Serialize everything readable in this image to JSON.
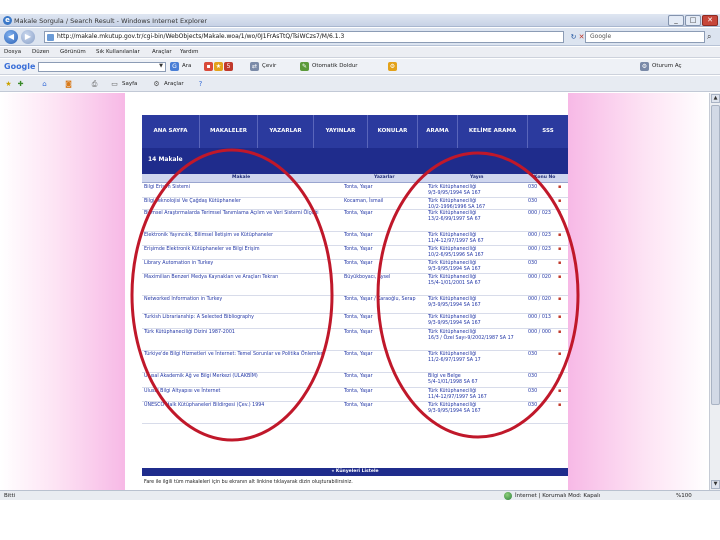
{
  "window": {
    "title": "Makale Sorgula / Search Result - Windows Internet Explorer",
    "btn_min": "_",
    "btn_max": "□",
    "btn_close": "✕"
  },
  "address": {
    "back": "◀",
    "forward": "▶",
    "url": "http://makale.mkutup.gov.tr/cgi-bin/WebObjects/Makale.woa/1/wo/0J1FrAsTtQ/TsiWCzs7/M/6.1.3",
    "refresh": "↻",
    "stop": "✕",
    "search_placeholder": "Google"
  },
  "menu": [
    "Dosya",
    "Düzen",
    "Görünüm",
    "Sık Kullanılanlar",
    "Araçlar",
    "Yardım"
  ],
  "google_toolbar": {
    "logo": "Google",
    "search_label": "Ara",
    "share_label": "Çevir",
    "autofill_label": "Otomatik Doldur",
    "signin_label": "Oturum Aç"
  },
  "fav_toolbar": {
    "page_label": "Sayfa",
    "tools_label": "Araçlar"
  },
  "nav": [
    "ANA SAYFA",
    "MAKALELER",
    "YAZARLAR",
    "YAYINLAR",
    "KONULAR",
    "ARAMA",
    "KELİME ARAMA",
    "SSS"
  ],
  "section_title": "14 Makale",
  "columns": {
    "title": "Makale",
    "author": "Yazarlar",
    "journal": "Yayın",
    "pages": "Konu No"
  },
  "rows": [
    {
      "title": "Bilgi Erişim Sistemi",
      "author": "Tonta, Yaşar",
      "journal": "Türk Kütüphaneciliği\n9/3-9/95/1994 SA 167",
      "pages": "030",
      "icon": "▪"
    },
    {
      "title": "Bilgi Teknolojisi Ve Çağdaş Kütüphaneler",
      "author": "Kocaman, İsmail",
      "journal": "Türk Kütüphaneciliği\n10/2-1996/1996 SA 167",
      "pages": "030",
      "icon": "▪"
    },
    {
      "title": "Bilimsel Araştırmalarda Terimsel Tanımlama Açılım ve Veri Sistemi Ölçeği",
      "author": "Tonta, Yaşar",
      "journal": "Türk Kütüphaneciliği\n13/2-6/99/1997 SA 67",
      "pages": "000 / 023",
      "icon": "▪"
    },
    {
      "title": "Elektronik Yayıncılık, Bilimsel İletişim ve Kütüphaneler",
      "author": "Tonta, Yaşar",
      "journal": "Türk Kütüphaneciliği\n11/4-12/97/1997 SA 67",
      "pages": "000 / 023",
      "icon": "▪"
    },
    {
      "title": "Erişimde Elektronik Kütüphaneler ve Bilgi Erişim",
      "author": "Tonta, Yaşar",
      "journal": "Türk Kütüphaneciliği\n10/2-6/95/1996 SA 167",
      "pages": "000 / 023",
      "icon": "▪"
    },
    {
      "title": "Library Automation in Turkey",
      "author": "Tonta, Yaşar",
      "journal": "Türk Kütüphaneciliği\n9/3-9/95/1994 SA 167",
      "pages": "030",
      "icon": "▪"
    },
    {
      "title": "Maximilian Benzeri Medya Kaynakları ve Araçları Tekrarı",
      "author": "Büyükboyacı, Aysel",
      "journal": "Türk Kütüphaneciliği\n15/4-1/01/2001 SA 67",
      "pages": "000 / 020",
      "icon": "▪"
    },
    {
      "title": "Networked Information in Turkey",
      "author": "Tonta, Yaşar / Karaoğlu, Serap",
      "journal": "Türk Kütüphaneciliği\n9/3-9/95/1994 SA 167",
      "pages": "000 / 020",
      "icon": "▪"
    },
    {
      "title": "Turkish Librarianship: A Selected Bibliography",
      "author": "Tonta, Yaşar",
      "journal": "Türk Kütüphaneciliği\n9/3-9/95/1994 SA 167",
      "pages": "000 / 013",
      "icon": "▪"
    },
    {
      "title": "Türk Kütüphaneciliği Dizini 1987-2001",
      "author": "Tonta, Yaşar",
      "journal": "Türk Kütüphaneciliği\n16/3 / Özel Sayı-9/2002/1987 SA 17",
      "pages": "000 / 000",
      "icon": "▪"
    },
    {
      "title": "Türkiye'de Bilgi Hizmetleri ve İnternet: Temel Sorunlar ve Politika Önlemleri",
      "author": "Tonta, Yaşar",
      "journal": "Türk Kütüphaneciliği\n11/2-6/97/1997 SA 17",
      "pages": "030",
      "icon": "▪"
    },
    {
      "title": "Ulusal Akademik Ağ ve Bilgi Merkezi (ULAKBİM)",
      "author": "Tonta, Yaşar",
      "journal": "Bilgi ve Belge\n5/4-1/01/1998 SA 67",
      "pages": "030",
      "icon": "▪"
    },
    {
      "title": "Ulusal Bilgi Altyapısı ve İnternet",
      "author": "Tonta, Yaşar",
      "journal": "Türk Kütüphaneciliği\n11/4-12/97/1997 SA 167",
      "pages": "030",
      "icon": "▪"
    },
    {
      "title": "ÜNESCO Halk Kütüphaneleri Bildirgesi (Çev.) 1994",
      "author": "Tonta, Yaşar",
      "journal": "Türk Kütüphaneciliği\n9/3-9/95/1994 SA 167",
      "pages": "030",
      "icon": "▪"
    }
  ],
  "footer_link": "« Künyeleri Listele",
  "note": "Fare ile ilgili tüm makaleleri için bu ekranın alt linkine tıklayarak dizin oluşturabilirsiniz.",
  "status": {
    "left": "Bitti",
    "zone": "İnternet | Korumalı Mod: Kapalı",
    "zoom": "%100"
  },
  "accent": {
    "nav": "#2b3a9e",
    "annotation": "#c0182a"
  }
}
